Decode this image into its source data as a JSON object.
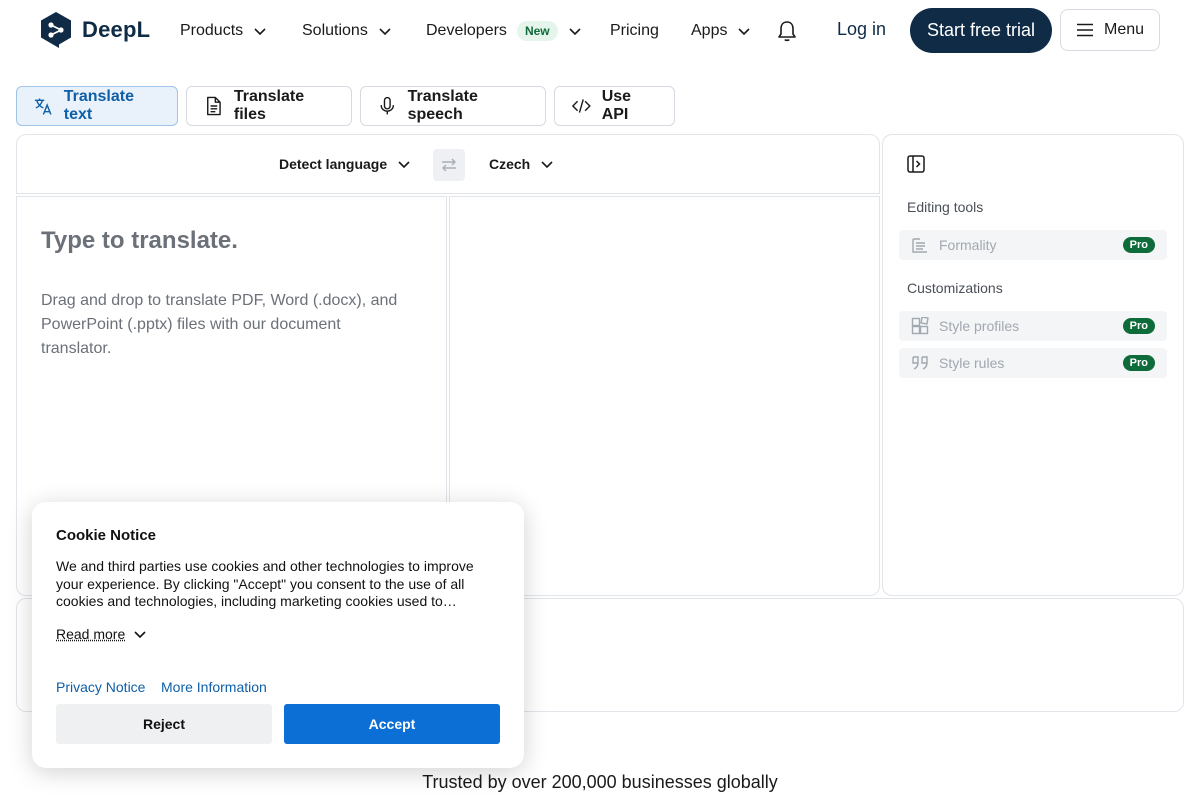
{
  "brand": {
    "name": "DeepL"
  },
  "nav": {
    "products": "Products",
    "solutions": "Solutions",
    "developers": "Developers",
    "developers_badge": "New",
    "pricing": "Pricing",
    "apps": "Apps",
    "login": "Log in",
    "trial": "Start free trial",
    "menu": "Menu"
  },
  "modes": [
    {
      "label": "Translate text",
      "icon": "translate-icon",
      "active": true
    },
    {
      "label": "Translate files",
      "icon": "document-icon",
      "active": false
    },
    {
      "label": "Translate speech",
      "icon": "microphone-icon",
      "active": false
    },
    {
      "label": "Use API",
      "icon": "code-icon",
      "active": false
    }
  ],
  "languages": {
    "source": "Detect language",
    "target": "Czech"
  },
  "source_pane": {
    "placeholder": "Type to translate.",
    "drop_hint": "Drag and drop to translate PDF, Word (.docx), and PowerPoint (.pptx) files with our document translator."
  },
  "side_panel": {
    "editing_heading": "Editing tools",
    "customizations_heading": "Customizations",
    "items": [
      {
        "label": "Formality",
        "badge": "Pro"
      },
      {
        "label": "Style profiles",
        "badge": "Pro"
      },
      {
        "label": "Style rules",
        "badge": "Pro"
      }
    ]
  },
  "trusted": "Trusted by over 200,000 businesses globally",
  "cookie": {
    "title": "Cookie Notice",
    "body": "We and third parties use cookies and other technologies to improve your experience. By clicking \"Accept\" you consent to the use of all cookies and technologies, including marketing cookies used to…",
    "read_more": "Read more",
    "privacy_link": "Privacy Notice",
    "more_info_link": "More Information",
    "reject": "Reject",
    "accept": "Accept"
  },
  "colors": {
    "brand_navy": "#0f2b46",
    "accent_blue": "#0b6fd6",
    "pro_green": "#0e6b3a"
  }
}
